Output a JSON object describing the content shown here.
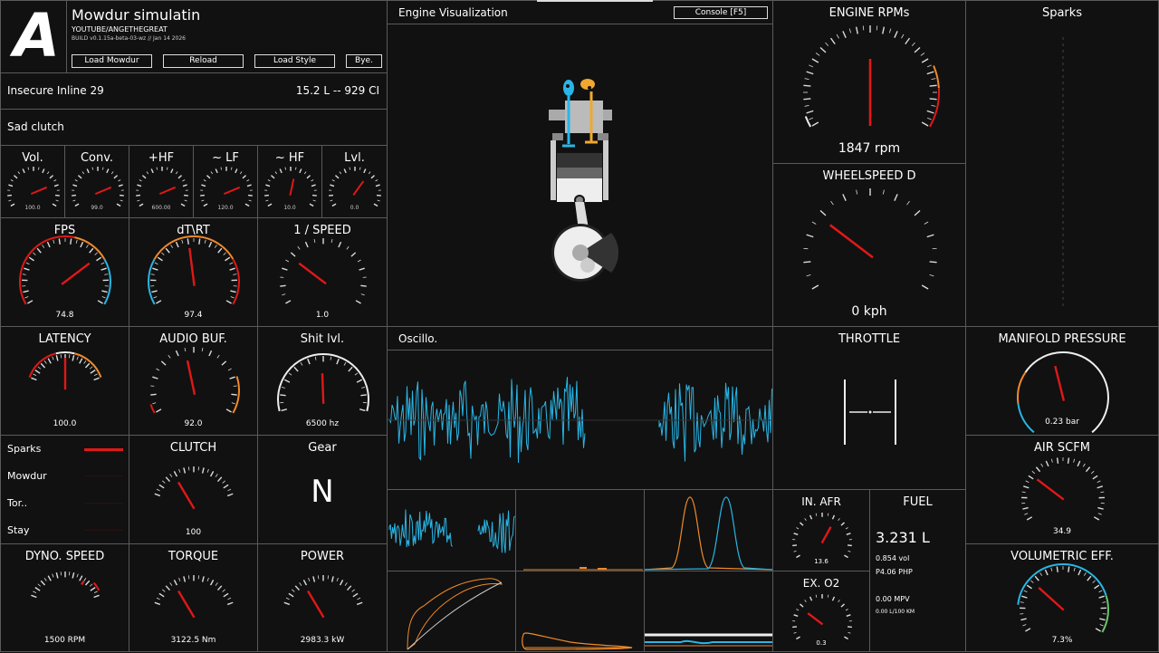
{
  "header": {
    "logo": "A",
    "title": "Mowdur simulatin",
    "subtitle": "YOUTUBE/ANGETHEGREAT",
    "build": "BUILD v0.1.15a-beta-03-wz // Jan 14 2026",
    "buttons": [
      "Load Mowdur",
      "Reload",
      "Load Style",
      "Bye."
    ]
  },
  "engine": {
    "name": "Insecure Inline 29",
    "displacement": "15.2 L -- 929 CI"
  },
  "transmission": {
    "name": "Sad clutch"
  },
  "small_gauges": [
    {
      "label": "Vol.",
      "value": "100.0",
      "frac": 0.78
    },
    {
      "label": "Conv.",
      "value": "99.0",
      "frac": 0.78
    },
    {
      "label": "+HF",
      "value": "600.00",
      "frac": 0.78
    },
    {
      "label": "~ LF",
      "value": "120.0",
      "frac": 0.78
    },
    {
      "label": "~ HF",
      "value": "10.0",
      "frac": 0.55
    },
    {
      "label": "Lvl.",
      "value": "0.0",
      "frac": 0.65
    }
  ],
  "perf_gauges": [
    {
      "label": "FPS",
      "value": "74.8",
      "frac": 0.72
    },
    {
      "label": "dT\\RT",
      "value": "97.4",
      "frac": 0.47
    },
    {
      "label": "1 / SPEED",
      "value": "1.0",
      "frac": 0.28
    }
  ],
  "row4_gauges": [
    {
      "label": "LATENCY",
      "value": "100.0",
      "frac": 0.5
    },
    {
      "label": "AUDIO BUF.",
      "value": "92.0",
      "frac": 0.45
    },
    {
      "label": "Shit lvl.",
      "value": "6500 hz",
      "frac": 0.49
    }
  ],
  "indicators": [
    {
      "label": "Sparks",
      "active": true
    },
    {
      "label": "Mowdur",
      "active": false
    },
    {
      "label": "Tor..",
      "active": false
    },
    {
      "label": "Stay",
      "active": false
    }
  ],
  "clutch": {
    "label": "CLUTCH",
    "value": "100",
    "frac": 0.28
  },
  "gear": {
    "label": "Gear",
    "value": "N"
  },
  "bottom_gauges": [
    {
      "label": "DYNO. SPEED",
      "value": "1500 RPM",
      "frac": 0.75
    },
    {
      "label": "TORQUE",
      "value": "3122.5 Nm",
      "frac": 0.28
    },
    {
      "label": "POWER",
      "value": "2983.3 kW",
      "frac": 0.28
    }
  ],
  "visualization": {
    "title": "Engine Visualization",
    "console_button": "Console [F5]"
  },
  "oscillo": {
    "title": "Oscillo."
  },
  "rpm": {
    "title": "ENGINE RPMs",
    "value": "1847 rpm",
    "frac": 0.5
  },
  "wheelspeed": {
    "title": "WHEELSPEED  D",
    "value": "0 kph",
    "frac": 0.28
  },
  "sparks": {
    "title": "Sparks"
  },
  "throttle": {
    "title": "THROTTLE"
  },
  "manifold": {
    "title": "MANIFOLD PRESSURE",
    "value": "0.23 bar",
    "frac": 0.45
  },
  "air": {
    "title": "AIR SCFM",
    "value": "34.9",
    "frac": 0.28
  },
  "volumetric": {
    "title": "VOLUMETRIC EFF.",
    "value": "7.3%",
    "frac": 0.3
  },
  "afr": {
    "title": "IN. AFR",
    "value": "13.6",
    "frac": 0.62
  },
  "o2": {
    "title": "EX. O2",
    "value": "0.3",
    "frac": 0.28
  },
  "fuel": {
    "title": "FUEL",
    "amount": "3.231 L",
    "vol": "0.854 vol",
    "php": "P4.06 PHP",
    "mpv": "0.00 MPV",
    "lkm": "0.00 L/100 KM"
  },
  "colors": {
    "needle": "#e01818",
    "accent_blue": "#29b6e6",
    "accent_orange": "#f08a2a",
    "border": "#5a5a5a"
  }
}
